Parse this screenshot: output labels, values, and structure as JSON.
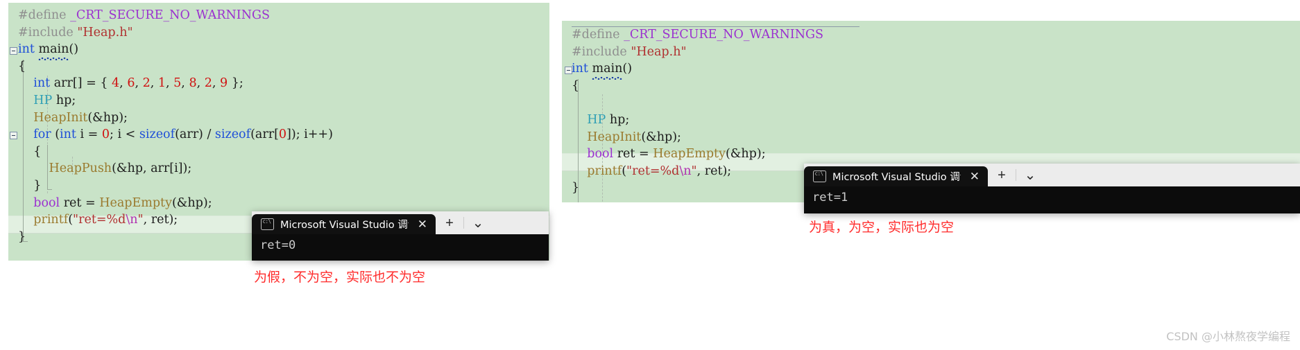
{
  "editors": [
    {
      "id": "left",
      "title": "left-code-editor",
      "lines": [
        [
          {
            "t": "#define ",
            "c": "pre"
          },
          {
            "t": "_CRT_SECURE_NO_WARNINGS",
            "c": "macro"
          }
        ],
        [
          {
            "t": "#include ",
            "c": "pre"
          },
          {
            "t": "\"Heap.h\"",
            "c": "str"
          }
        ],
        [
          {
            "t": "int ",
            "c": "kw"
          },
          {
            "t": "main",
            "c": "pl",
            "squiggle": true
          },
          {
            "t": "()",
            "c": "pl"
          }
        ],
        [
          {
            "t": "{",
            "c": "pl"
          }
        ],
        [
          {
            "t": "    int ",
            "c": "kw"
          },
          {
            "t": "arr[] = { ",
            "c": "pl"
          },
          {
            "t": "4",
            "c": "num"
          },
          {
            "t": ", ",
            "c": "pl"
          },
          {
            "t": "6",
            "c": "num"
          },
          {
            "t": ", ",
            "c": "pl"
          },
          {
            "t": "2",
            "c": "num"
          },
          {
            "t": ", ",
            "c": "pl"
          },
          {
            "t": "1",
            "c": "num"
          },
          {
            "t": ", ",
            "c": "pl"
          },
          {
            "t": "5",
            "c": "num"
          },
          {
            "t": ", ",
            "c": "pl"
          },
          {
            "t": "8",
            "c": "num"
          },
          {
            "t": ", ",
            "c": "pl"
          },
          {
            "t": "2",
            "c": "num"
          },
          {
            "t": ", ",
            "c": "pl"
          },
          {
            "t": "9",
            "c": "num"
          },
          {
            "t": " };",
            "c": "pl"
          }
        ],
        [
          {
            "t": "    ",
            "c": "pl"
          },
          {
            "t": "HP",
            "c": "type"
          },
          {
            "t": " hp;",
            "c": "pl"
          }
        ],
        [
          {
            "t": "    ",
            "c": "pl"
          },
          {
            "t": "HeapInit",
            "c": "fn"
          },
          {
            "t": "(&hp);",
            "c": "pl"
          }
        ],
        [
          {
            "t": "    for ",
            "c": "kw"
          },
          {
            "t": "(",
            "c": "pl"
          },
          {
            "t": "int ",
            "c": "kw"
          },
          {
            "t": "i = ",
            "c": "pl"
          },
          {
            "t": "0",
            "c": "num"
          },
          {
            "t": "; i < ",
            "c": "pl"
          },
          {
            "t": "sizeof",
            "c": "kw"
          },
          {
            "t": "(arr) / ",
            "c": "pl"
          },
          {
            "t": "sizeof",
            "c": "kw"
          },
          {
            "t": "(arr[",
            "c": "pl"
          },
          {
            "t": "0",
            "c": "num"
          },
          {
            "t": "]); i++)",
            "c": "pl"
          }
        ],
        [
          {
            "t": "    {",
            "c": "pl"
          }
        ],
        [
          {
            "t": "        ",
            "c": "pl"
          },
          {
            "t": "HeapPush",
            "c": "fn"
          },
          {
            "t": "(&hp, arr[i]);",
            "c": "pl"
          }
        ],
        [
          {
            "t": "    }",
            "c": "pl"
          }
        ],
        [
          {
            "t": "    bool ",
            "c": "kw2"
          },
          {
            "t": "ret = ",
            "c": "pl"
          },
          {
            "t": "HeapEmpty",
            "c": "fn"
          },
          {
            "t": "(&hp);",
            "c": "pl"
          }
        ],
        [
          {
            "t": "    ",
            "c": "pl"
          },
          {
            "t": "printf",
            "c": "fn"
          },
          {
            "t": "(",
            "c": "pl"
          },
          {
            "t": "\"ret=%d",
            "c": "str"
          },
          {
            "t": "\\n",
            "c": "esc"
          },
          {
            "t": "\"",
            "c": "str"
          },
          {
            "t": ", ret);",
            "c": "pl"
          }
        ],
        [
          {
            "t": "}",
            "c": "pl"
          }
        ]
      ],
      "highlighted_line_index": 12
    },
    {
      "id": "right",
      "title": "right-code-editor",
      "lines": [
        [
          {
            "t": "#define ",
            "c": "pre"
          },
          {
            "t": "_CRT_SECURE_NO_WARNINGS",
            "c": "macro"
          }
        ],
        [
          {
            "t": "#include ",
            "c": "pre"
          },
          {
            "t": "\"Heap.h\"",
            "c": "str"
          }
        ],
        [
          {
            "t": "int ",
            "c": "kw"
          },
          {
            "t": "main",
            "c": "pl",
            "squiggle": true
          },
          {
            "t": "()",
            "c": "pl"
          }
        ],
        [
          {
            "t": "{",
            "c": "pl"
          }
        ],
        [
          {
            "t": "",
            "c": "pl"
          }
        ],
        [
          {
            "t": "    ",
            "c": "pl"
          },
          {
            "t": "HP",
            "c": "type"
          },
          {
            "t": " hp;",
            "c": "pl"
          }
        ],
        [
          {
            "t": "    ",
            "c": "pl"
          },
          {
            "t": "HeapInit",
            "c": "fn"
          },
          {
            "t": "(&hp);",
            "c": "pl"
          }
        ],
        [
          {
            "t": "    bool ",
            "c": "kw2"
          },
          {
            "t": "ret = ",
            "c": "pl"
          },
          {
            "t": "HeapEmpty",
            "c": "fn"
          },
          {
            "t": "(&hp);",
            "c": "pl"
          }
        ],
        [
          {
            "t": "    ",
            "c": "pl"
          },
          {
            "t": "printf",
            "c": "fn"
          },
          {
            "t": "(",
            "c": "pl"
          },
          {
            "t": "\"ret=%d",
            "c": "str"
          },
          {
            "t": "\\n",
            "c": "esc"
          },
          {
            "t": "\"",
            "c": "str"
          },
          {
            "t": ", ret);",
            "c": "pl"
          }
        ],
        [
          {
            "t": "}",
            "c": "pl"
          }
        ]
      ],
      "highlighted_line_index": 6
    }
  ],
  "terminals": [
    {
      "id": "left-terminal",
      "tab_title": "Microsoft Visual Studio 调试控",
      "close_label": "✕",
      "new_tab_label": "+",
      "dropdown_label": "⌄",
      "output": "ret=0"
    },
    {
      "id": "right-terminal",
      "tab_title": "Microsoft Visual Studio 调试控",
      "close_label": "✕",
      "new_tab_label": "+",
      "dropdown_label": "⌄",
      "output": "ret=1"
    }
  ],
  "annotations": {
    "left_note": "为假，不为空，实际也不为空",
    "right_note": "为真，为空，实际也为空"
  },
  "watermark": "CSDN @小林熬夜学编程",
  "colors": {
    "editor_background": "#c9e3c8",
    "annotation_red": "#ff2b2b",
    "terminal_background": "#0c0c0c",
    "terminal_bar": "#ececec",
    "watermark_gray": "#c2c2c2"
  }
}
